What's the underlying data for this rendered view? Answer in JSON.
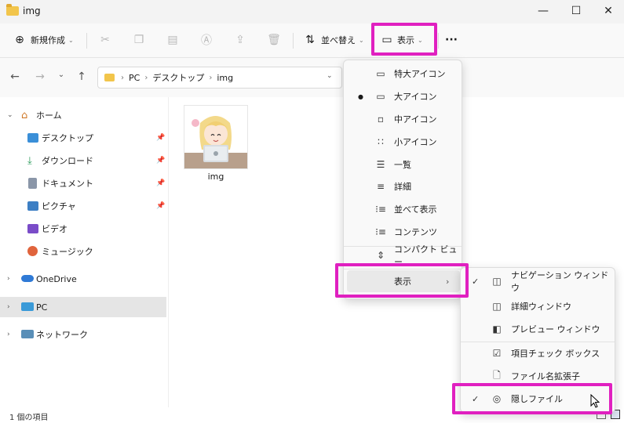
{
  "window": {
    "title": "img"
  },
  "title_controls": {
    "minimize": "—",
    "maximize": "☐",
    "close": "✕"
  },
  "toolbar": {
    "new_label": "新規作成",
    "sort_label": "並べ替え",
    "view_label": "表示",
    "more_label": "···"
  },
  "address": {
    "crumbs": [
      "PC",
      "デスクトップ",
      "img"
    ]
  },
  "sidebar": {
    "items": [
      {
        "label": "ホーム"
      },
      {
        "label": "デスクトップ"
      },
      {
        "label": "ダウンロード"
      },
      {
        "label": "ドキュメント"
      },
      {
        "label": "ピクチャ"
      },
      {
        "label": "ビデオ"
      },
      {
        "label": "ミュージック"
      },
      {
        "label": "OneDrive"
      },
      {
        "label": "PC"
      },
      {
        "label": "ネットワーク"
      }
    ]
  },
  "content": {
    "files": [
      {
        "name": "img"
      }
    ]
  },
  "status": {
    "count": "1 個の項目"
  },
  "view_menu": {
    "items": [
      {
        "label": "特大アイコン"
      },
      {
        "label": "大アイコン"
      },
      {
        "label": "中アイコン"
      },
      {
        "label": "小アイコン"
      },
      {
        "label": "一覧"
      },
      {
        "label": "詳細"
      },
      {
        "label": "並べて表示"
      },
      {
        "label": "コンテンツ"
      },
      {
        "label": "コンパクト ビュー"
      },
      {
        "label": "表示"
      }
    ],
    "selected_index": 1
  },
  "show_submenu": {
    "items": [
      {
        "label": "ナビゲーション ウィンドウ",
        "checked": true
      },
      {
        "label": "詳細ウィンドウ",
        "checked": false
      },
      {
        "label": "プレビュー ウィンドウ",
        "checked": false
      },
      {
        "label": "項目チェック ボックス",
        "checked": false
      },
      {
        "label": "ファイル名拡張子",
        "checked": false
      },
      {
        "label": "隠しファイル",
        "checked": true
      }
    ]
  },
  "colors": {
    "highlight": "#e020c0",
    "folder": "#f2c54b",
    "selected_bg": "#e5e5e5"
  }
}
